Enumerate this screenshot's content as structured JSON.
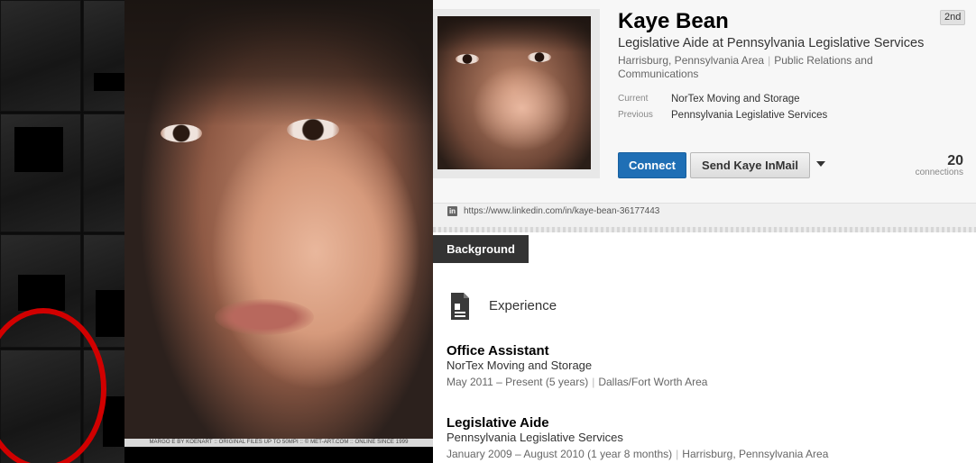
{
  "left_panel": {
    "image_caption": "MARGO E BY KOENART :: ORIGINAL FILES UP TO 50MPI :: © MET-ART.COM :: ONLINE SINCE 1999"
  },
  "profile": {
    "name": "Kaye Bean",
    "degree": "2nd",
    "headline": "Legislative Aide at Pennsylvania Legislative Services",
    "location": "Harrisburg, Pennsylvania Area",
    "industry": "Public Relations and Communications",
    "current_label": "Current",
    "current_value": "NorTex Moving and Storage",
    "previous_label": "Previous",
    "previous_value": "Pennsylvania Legislative Services",
    "connect_label": "Connect",
    "inmail_label": "Send Kaye InMail",
    "connections_count": "20",
    "connections_label": "connections",
    "linkedin_icon": "in",
    "url": "https://www.linkedin.com/in/kaye-bean-36177443"
  },
  "background_tab": "Background",
  "experience": {
    "title": "Experience",
    "icon": "document-icon",
    "jobs": [
      {
        "title": "Office Assistant",
        "company": "NorTex Moving and Storage",
        "dates": "May 2011 – Present (5 years)",
        "location": "Dallas/Fort Worth Area"
      },
      {
        "title": "Legislative Aide",
        "company": "Pennsylvania Legislative Services",
        "dates": "January 2009 – August 2010 (1 year 8 months)",
        "location": "Harrisburg, Pennsylvania Area"
      }
    ]
  },
  "colors": {
    "connect_blue": "#1f6fb5",
    "circle_red": "#d10000"
  }
}
